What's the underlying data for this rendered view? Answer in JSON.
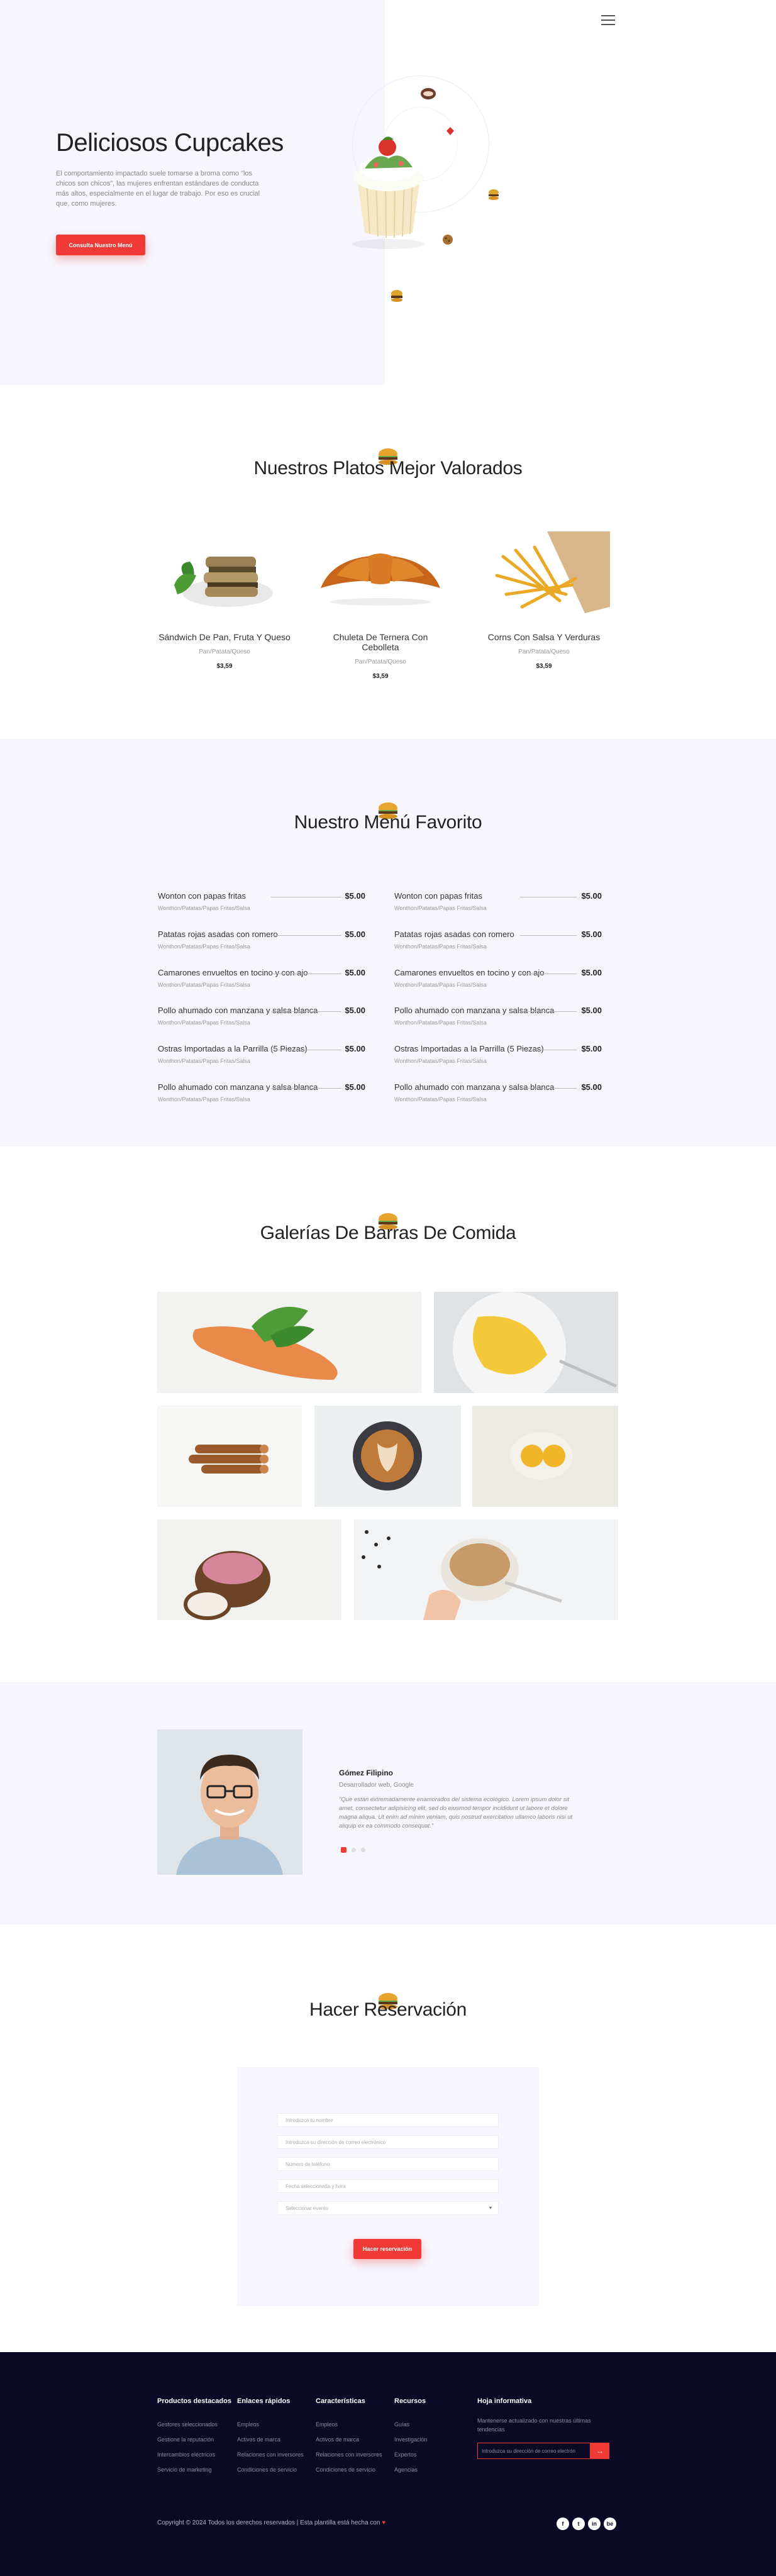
{
  "hero": {
    "title": "Deliciosos Cupcakes",
    "description": "El comportamiento impactado suele tomarse a broma como \"los chicos son chicos\", las mujeres enfrentan estándares de conducta más altos, especialmente en el lugar de trabajo. Por eso es crucial que, como mujeres.",
    "button": "Consulta Nuestro Menú"
  },
  "top_rated": {
    "title": "Nuestros Platos Mejor Valorados",
    "dishes": [
      {
        "name": "Sándwich De Pan, Fruta Y Queso",
        "sub": "Pan/Patata/Queso",
        "price": "$3,59"
      },
      {
        "name": "Chuleta De Ternera Con Cebolleta",
        "sub": "Pan/Patata/Queso",
        "price": "$3,59"
      },
      {
        "name": "Corns Con Salsa Y Verduras",
        "sub": "Pan/Patata/Queso",
        "price": "$3,59"
      }
    ]
  },
  "favorite_menu": {
    "title": "Nuestro Menú Favorito",
    "left": [
      {
        "name": "Wonton con papas fritas",
        "sub": "Wonthon/Patatas/Papas Fritas/Salsa",
        "price": "$5.00"
      },
      {
        "name": "Patatas rojas asadas con romero",
        "sub": "Wonthon/Patatas/Papas Fritas/Salsa",
        "price": "$5.00"
      },
      {
        "name": "Camarones envueltos en tocino y con ajo",
        "sub": "Wonthon/Patatas/Papas Fritas/Salsa",
        "price": "$5.00"
      },
      {
        "name": "Pollo ahumado con manzana y salsa blanca",
        "sub": "Wonthon/Patatas/Papas Fritas/Salsa",
        "price": "$5.00"
      },
      {
        "name": "Ostras Importadas a la Parrilla (5 Piezas)",
        "sub": "Wonthon/Patatas/Papas Fritas/Salsa",
        "price": "$5.00"
      },
      {
        "name": "Pollo ahumado con manzana y salsa blanca",
        "sub": "Wonthon/Patatas/Papas Fritas/Salsa",
        "price": "$5.00"
      }
    ],
    "right": [
      {
        "name": "Wonton con papas fritas",
        "sub": "Wonthon/Patatas/Papas Fritas/Salsa",
        "price": "$5.00"
      },
      {
        "name": "Patatas rojas asadas con romero",
        "sub": "Wonthon/Patatas/Papas Fritas/Salsa",
        "price": "$5.00"
      },
      {
        "name": "Camarones envueltos en tocino y con ajo",
        "sub": "Wonthon/Patatas/Papas Fritas/Salsa",
        "price": "$5.00"
      },
      {
        "name": "Pollo ahumado con manzana y salsa blanca",
        "sub": "Wonthon/Patatas/Papas Fritas/Salsa",
        "price": "$5.00"
      },
      {
        "name": "Ostras Importadas a la Parrilla (5 Piezas)",
        "sub": "Wonthon/Patatas/Papas Fritas/Salsa",
        "price": "$5.00"
      },
      {
        "name": "Pollo ahumado con manzana y salsa blanca",
        "sub": "Wonthon/Patatas/Papas Fritas/Salsa",
        "price": "$5.00"
      }
    ]
  },
  "gallery": {
    "title": "Galerías De Barras De Comida"
  },
  "testimonial": {
    "name": "Gómez Filipino",
    "role": "Desarrollador web, Google",
    "quote": "\"Que están extremadamente enamorados del sistema ecológico. Lorem ipsum dolor sit amet, consectetur adipisicing elit, sed do eiusmod tempor incididunt ut labore et dolore magna aliqua. Ut enim ad minim veniam, quis nostrud exercitation ullamco laboris nisi ut aliquip ex ea commodo consequat.\""
  },
  "reservation": {
    "title": "Hacer Reservación",
    "fields": [
      "Introduzca tu nombre",
      "Introduzca su dirección de correo electrónico",
      "Número de teléfono",
      "Fecha seleccionada y hora",
      "Seleccionar evento"
    ],
    "button": "Hacer reservación"
  },
  "footer": {
    "columns": [
      {
        "title": "Productos destacados",
        "links": [
          "Gestores seleccionados",
          "Gestione la reputación",
          "Intercambios eléctricos",
          "Servicio de marketing"
        ]
      },
      {
        "title": "Enlaces rápidos",
        "links": [
          "Empleos",
          "Activos de marca",
          "Relaciones con inversores",
          "Condiciones de servicio"
        ]
      },
      {
        "title": "Características",
        "links": [
          "Empleos",
          "Activos de marca",
          "Relaciones con inversores",
          "Condiciones de servicio"
        ]
      },
      {
        "title": "Recursos",
        "links": [
          "Guías",
          "Investigación",
          "Expertos",
          "Agencias"
        ]
      }
    ],
    "newsletter": {
      "title": "Hoja informativa",
      "text": "Mantenerse actualizado con nuestras últimas tendencias",
      "placeholder": "Introduzca su dirección de correo electrón"
    },
    "copyright": "Copyright © 2024 Todos los derechos reservados | Esta plantilla está hecha con",
    "social": [
      "f",
      "t",
      "in",
      "be"
    ]
  },
  "colors": {
    "accent": "#ef3a36",
    "footer_bg": "#0b0a26",
    "section_bg": "#f7f6fd"
  }
}
